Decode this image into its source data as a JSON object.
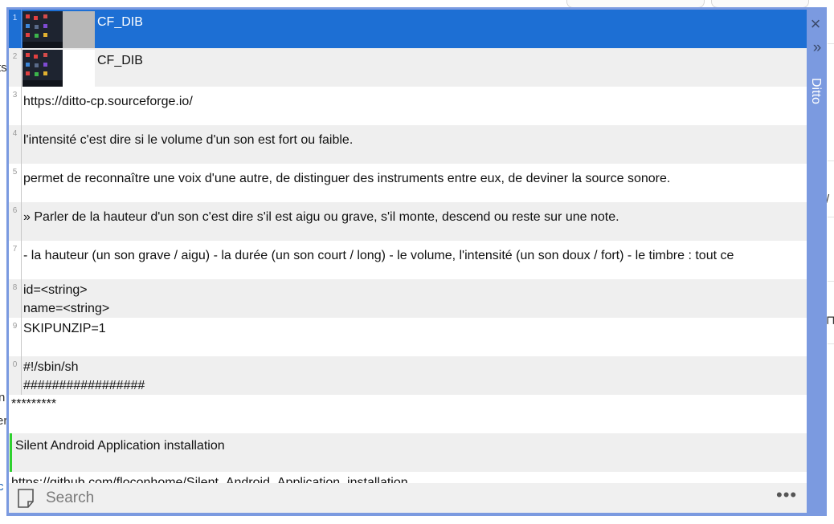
{
  "background": {
    "frag_ts": "ts",
    "frag_n": "n",
    "frag_er": "er",
    "frag_c": "c",
    "frag_slash": "/",
    "frag_trash": "⊓"
  },
  "ditto": {
    "title": "Ditto",
    "close_glyph": "×",
    "expand_glyph": "»"
  },
  "clips": [
    {
      "index": "1",
      "text": "CF_DIB",
      "type": "image",
      "selected": true
    },
    {
      "index": "2",
      "text": "CF_DIB",
      "type": "image"
    },
    {
      "index": "3",
      "text": "https://ditto-cp.sourceforge.io/"
    },
    {
      "index": "4",
      "text": "l'intensité c'est dire si le volume d'un son est fort ou faible."
    },
    {
      "index": "5",
      "text": "permet de reconnaître une voix d'une autre, de distinguer des instruments entre eux, de deviner la source sonore."
    },
    {
      "index": "6",
      "text": "» Parler de la hauteur d'un son c'est dire s'il est aigu ou grave, s'il monte, descend ou reste sur une note."
    },
    {
      "index": "7",
      "text": "- la hauteur (un son grave / aigu) - la durée (un son court / long) - le volume, l'intensité (un son doux / fort) - le timbre : tout ce"
    },
    {
      "index": "8",
      "line1": "id=<string>",
      "line2": "name=<string>"
    },
    {
      "index": "9",
      "text": "SKIPUNZIP=1"
    },
    {
      "index": "0",
      "line1": "#!/sbin/sh",
      "line2": "#################"
    },
    {
      "text": "*********"
    },
    {
      "text": "Silent Android Application installation"
    },
    {
      "text": "https://github.com/floconhome/Silent_Android_Application_installation"
    }
  ],
  "search": {
    "placeholder": "Search",
    "more_glyph": "•••"
  },
  "colors": {
    "accent_border": "#7b9ae0",
    "selected_row": "#1d6fd4",
    "group_marker": "#2fd12f"
  }
}
